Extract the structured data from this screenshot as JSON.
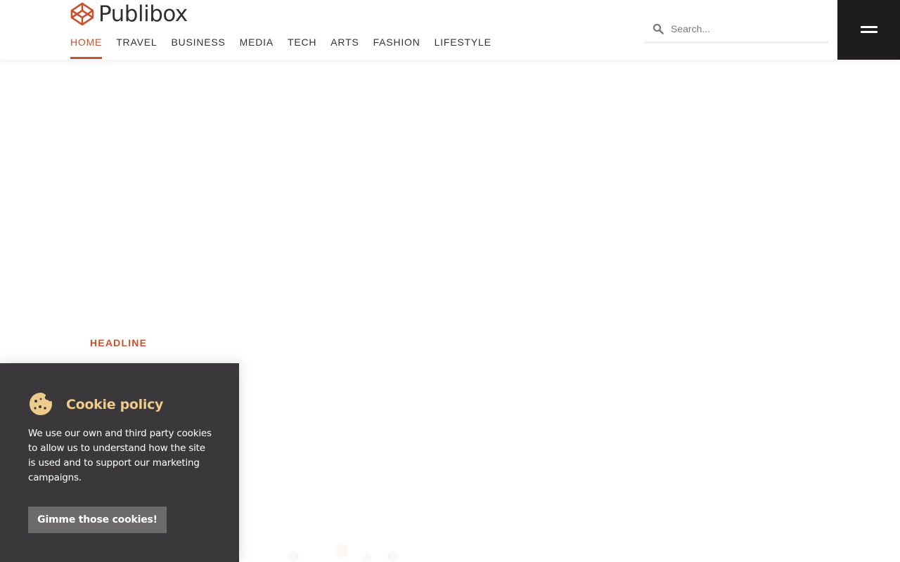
{
  "brand": {
    "name": "Publibox",
    "accent_color": "#c8512e",
    "logo_icon": "codepen-cube-icon"
  },
  "nav": {
    "items": [
      {
        "label": "HOME",
        "active": true
      },
      {
        "label": "TRAVEL",
        "active": false
      },
      {
        "label": "BUSINESS",
        "active": false
      },
      {
        "label": "MEDIA",
        "active": false
      },
      {
        "label": "TECH",
        "active": false
      },
      {
        "label": "ARTS",
        "active": false
      },
      {
        "label": "FASHION",
        "active": false
      },
      {
        "label": "LIFESTYLE",
        "active": false
      }
    ]
  },
  "search": {
    "placeholder": "Search...",
    "icon": "search-icon"
  },
  "menu": {
    "icon": "hamburger-menu-icon",
    "background": "#1f1d1c"
  },
  "content": {
    "headline_label": "HEADLINE"
  },
  "cookie": {
    "icon": "cookie-icon",
    "title": "Cookie policy",
    "text": "We use our own and third party cookies to allow us to understand how the site is used and to support our marketing campaigns.",
    "button_label": "Gimme those cookies!",
    "background": "#3a383b",
    "title_color": "#edcb8a"
  }
}
